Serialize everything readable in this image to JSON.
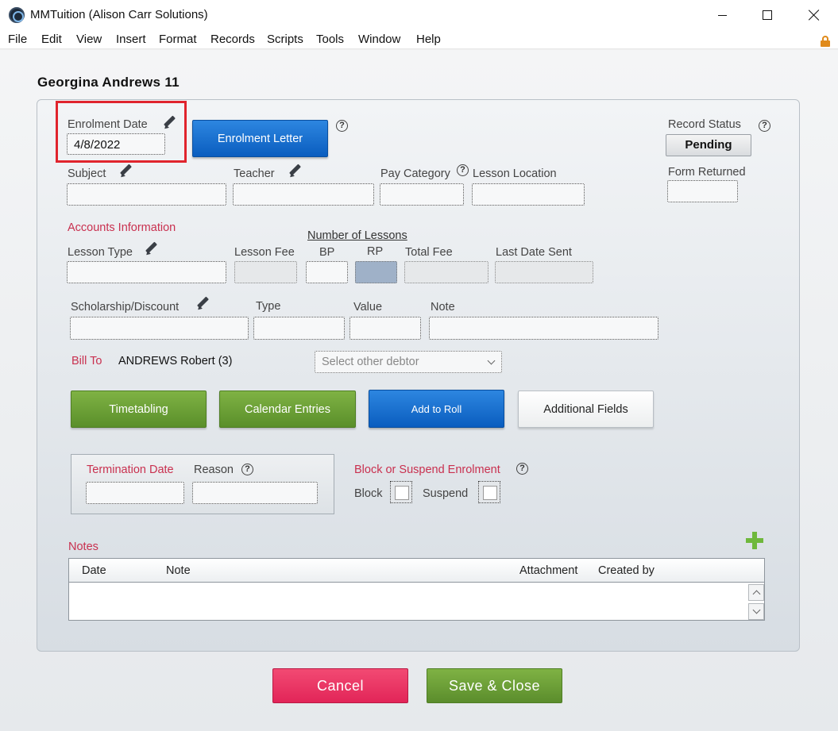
{
  "window": {
    "title": "MMTuition (Alison Carr Solutions)"
  },
  "menu": [
    "File",
    "Edit",
    "View",
    "Insert",
    "Format",
    "Records",
    "Scripts",
    "Tools",
    "Window",
    "Help"
  ],
  "record": {
    "title": "Georgina Andrews 11"
  },
  "enrolment": {
    "date_label": "Enrolment Date",
    "date_value": "4/8/2022",
    "letter_button": "Enrolment Letter",
    "record_status_label": "Record Status",
    "record_status_value": "Pending",
    "form_returned_label": "Form Returned"
  },
  "fields": {
    "subject": "Subject",
    "teacher": "Teacher",
    "pay_category": "Pay Category",
    "lesson_location": "Lesson Location"
  },
  "accounts": {
    "heading": "Accounts Information",
    "lesson_type": "Lesson Type",
    "lesson_fee": "Lesson Fee",
    "number_of_lessons": "Number of Lessons",
    "bp": "BP",
    "rp": "RP",
    "total_fee": "Total Fee",
    "last_date_sent": "Last Date Sent",
    "scholarship": "Scholarship/Discount",
    "type": "Type",
    "value": "Value",
    "note": "Note",
    "bill_to_label": "Bill To",
    "bill_to_value": "ANDREWS Robert (3)",
    "debtor_placeholder": "Select other debtor"
  },
  "actions": {
    "timetabling": "Timetabling",
    "calendar_entries": "Calendar Entries",
    "add_to_roll": "Add to Roll",
    "additional_fields": "Additional Fields"
  },
  "termination": {
    "date_label": "Termination Date",
    "reason_label": "Reason",
    "block_suspend_label": "Block or Suspend Enrolment",
    "block": "Block",
    "suspend": "Suspend"
  },
  "notes": {
    "heading": "Notes",
    "columns": [
      "Date",
      "Note",
      "Attachment",
      "Created by"
    ]
  },
  "footer": {
    "cancel": "Cancel",
    "save_close": "Save & Close"
  },
  "icons": {
    "help": "?"
  }
}
